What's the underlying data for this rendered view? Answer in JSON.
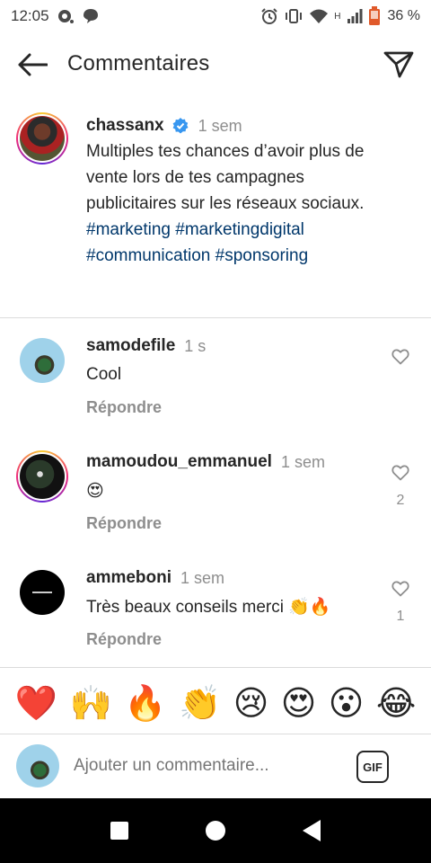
{
  "status_bar": {
    "time": "12:05",
    "network_type": "H",
    "battery": "36 %"
  },
  "header": {
    "title": "Commentaires"
  },
  "caption": {
    "username": "chassanx",
    "time": "1 sem",
    "text": "Multiples tes chances d’avoir plus de vente lors de tes campagnes publicitaires sur les réseaux sociaux.",
    "hashtags_line1": "#marketing #marketingdigital",
    "hashtags_line2": "#communication #sponsoring"
  },
  "comments": [
    {
      "username": "samodefile",
      "time": "1 s",
      "text": "Cool",
      "reply": "Répondre",
      "likes": ""
    },
    {
      "username": "mamoudou_emmanuel",
      "time": "1 sem",
      "text": "😍",
      "reply": "Répondre",
      "likes": "2"
    },
    {
      "username": "ammeboni",
      "time": "1 sem",
      "text": "Très beaux conseils merci 👏🔥",
      "reply": "Répondre",
      "likes": "1"
    }
  ],
  "emoji_bar": [
    "❤️",
    "🙌",
    "🔥",
    "👏",
    "😢",
    "😍",
    "😮",
    "😂"
  ],
  "input": {
    "placeholder": "Ajouter un commentaire...",
    "gif_label": "GIF"
  },
  "colors": {
    "hashtag": "#00376b",
    "muted": "#8e8e8e",
    "verified": "#3897f0"
  }
}
